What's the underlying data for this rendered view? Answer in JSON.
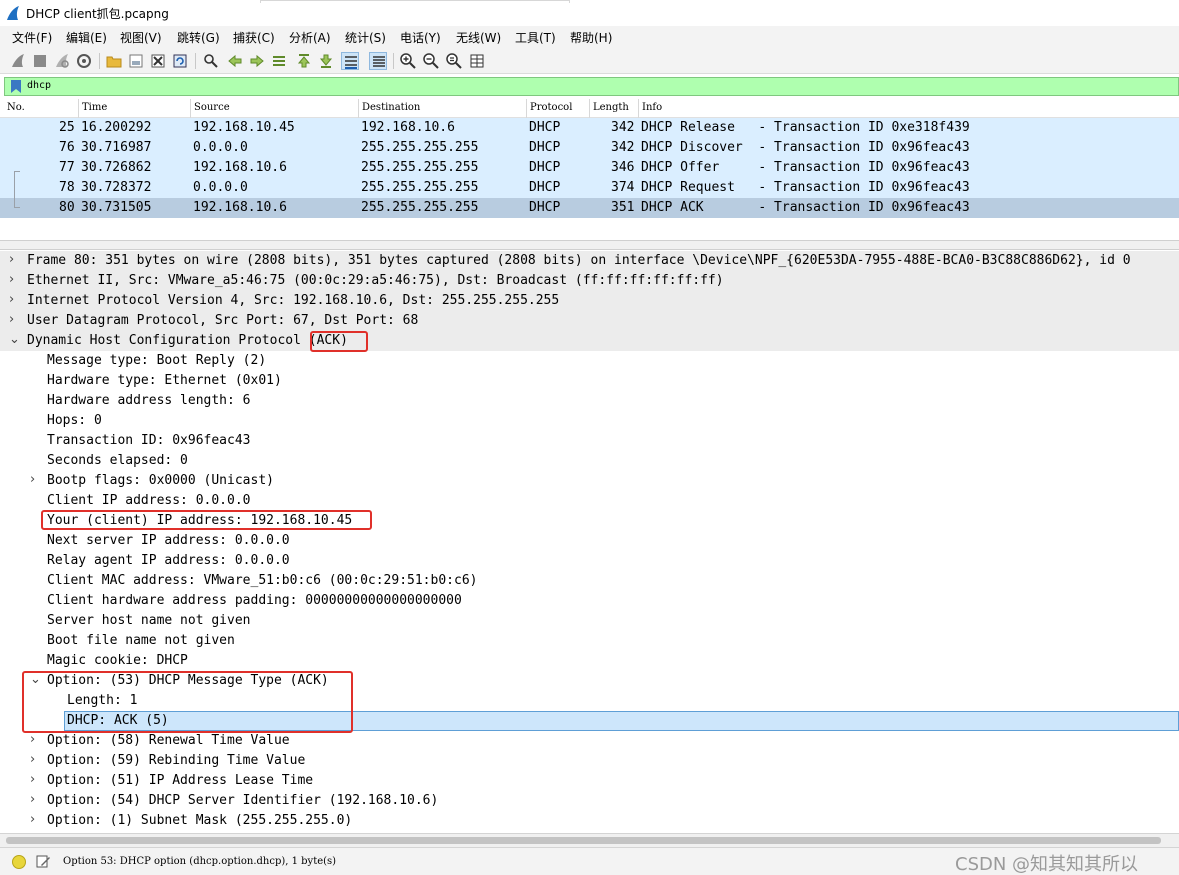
{
  "window": {
    "title": "DHCP client抓包.pcapng"
  },
  "menu": [
    "文件(F)",
    "编辑(E)",
    "视图(V)",
    "跳转(G)",
    "捕获(C)",
    "分析(A)",
    "统计(S)",
    "电话(Y)",
    "无线(W)",
    "工具(T)",
    "帮助(H)"
  ],
  "toolbar": {
    "icons": [
      "start-capture-icon",
      "stop-capture-icon",
      "restart-capture-icon",
      "capture-options-icon",
      "open-file-icon",
      "save-file-icon",
      "close-file-icon",
      "reload-file-icon",
      "find-packet-icon",
      "go-back-icon",
      "go-forward-icon",
      "go-to-packet-icon",
      "go-first-icon",
      "go-last-icon",
      "auto-scroll-icon",
      "colorize-icon",
      "zoom-in-icon",
      "zoom-out-icon",
      "zoom-normal-icon",
      "resize-columns-icon"
    ],
    "active": [
      "auto-scroll-icon",
      "colorize-icon"
    ]
  },
  "filter": {
    "value": "dhcp"
  },
  "packet_list": {
    "columns": [
      "No.",
      "Time",
      "Source",
      "Destination",
      "Protocol",
      "Length",
      "Info"
    ],
    "rows": [
      {
        "no": "25",
        "time": "16.200292",
        "source": "192.168.10.45",
        "destination": "192.168.10.6",
        "protocol": "DHCP",
        "length": "342",
        "info": "DHCP Release   - Transaction ID 0xe318f439",
        "selected": false
      },
      {
        "no": "76",
        "time": "30.716987",
        "source": "0.0.0.0",
        "destination": "255.255.255.255",
        "protocol": "DHCP",
        "length": "342",
        "info": "DHCP Discover  - Transaction ID 0x96feac43",
        "selected": false
      },
      {
        "no": "77",
        "time": "30.726862",
        "source": "192.168.10.6",
        "destination": "255.255.255.255",
        "protocol": "DHCP",
        "length": "346",
        "info": "DHCP Offer     - Transaction ID 0x96feac43",
        "selected": false
      },
      {
        "no": "78",
        "time": "30.728372",
        "source": "0.0.0.0",
        "destination": "255.255.255.255",
        "protocol": "DHCP",
        "length": "374",
        "info": "DHCP Request   - Transaction ID 0x96feac43",
        "selected": false
      },
      {
        "no": "80",
        "time": "30.731505",
        "source": "192.168.10.6",
        "destination": "255.255.255.255",
        "protocol": "DHCP",
        "length": "351",
        "info": "DHCP ACK       - Transaction ID 0x96feac43",
        "selected": true
      }
    ]
  },
  "details": {
    "frame": "Frame 80: 351 bytes on wire (2808 bits), 351 bytes captured (2808 bits) on interface \\Device\\NPF_{620E53DA-7955-488E-BCA0-B3C88C886D62}, id 0",
    "ethernet": "Ethernet II, Src: VMware_a5:46:75 (00:0c:29:a5:46:75), Dst: Broadcast (ff:ff:ff:ff:ff:ff)",
    "ip": "Internet Protocol Version 4, Src: 192.168.10.6, Dst: 255.255.255.255",
    "udp": "User Datagram Protocol, Src Port: 67, Dst Port: 68",
    "dhcp_prefix": "Dynamic Host Configuration Protocol ",
    "dhcp_suffix": "(ACK)",
    "message_type": "Message type: Boot Reply (2)",
    "hardware_type": "Hardware type: Ethernet (0x01)",
    "hw_addr_len": "Hardware address length: 6",
    "hops": "Hops: 0",
    "transaction_id": "Transaction ID: 0x96feac43",
    "seconds": "Seconds elapsed: 0",
    "bootp_flags": "Bootp flags: 0x0000 (Unicast)",
    "client_ip": "Client IP address: 0.0.0.0",
    "your_ip": "Your (client) IP address: 192.168.10.45",
    "next_server": "Next server IP address: 0.0.0.0",
    "relay_agent": "Relay agent IP address: 0.0.0.0",
    "client_mac": "Client MAC address: VMware_51:b0:c6 (00:0c:29:51:b0:c6)",
    "hw_padding": "Client hardware address padding: 00000000000000000000",
    "server_host": "Server host name not given",
    "boot_file": "Boot file name not given",
    "magic_cookie": "Magic cookie: DHCP",
    "option53": "Option: (53) DHCP Message Type (ACK)",
    "option53_length": "Length: 1",
    "option53_value": "DHCP: ACK (5)",
    "option58": "Option: (58) Renewal Time Value",
    "option59": "Option: (59) Rebinding Time Value",
    "option51": "Option: (51) IP Address Lease Time",
    "option54": "Option: (54) DHCP Server Identifier (192.168.10.6)",
    "option1": "Option: (1) Subnet Mask (255.255.255.0)"
  },
  "status": {
    "text": "Option 53: DHCP option (dhcp.option.dhcp), 1 byte(s)",
    "watermark": "CSDN @知其知其所以"
  },
  "colors": {
    "filter_bg": "#afffaf",
    "row_blue": "#daeeff",
    "row_selected": "#b8cce0",
    "highlight_box": "#e0302a",
    "field_selected": "#cde6fb"
  }
}
